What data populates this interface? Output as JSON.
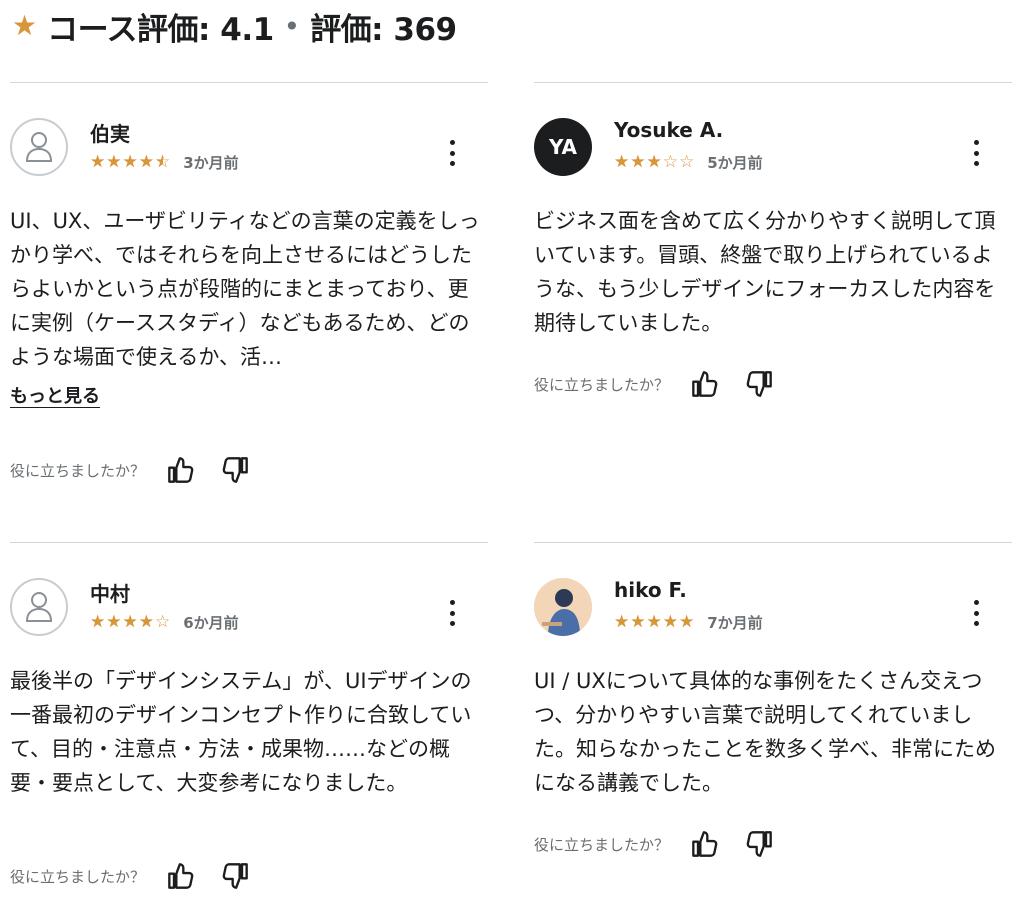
{
  "header": {
    "title": "コース評価: 4.1",
    "separator": "•",
    "count": "評価: 369",
    "accent_color": "#d8963a"
  },
  "helpful_prompt": "役に立ちましたか？",
  "reviews": [
    {
      "name": "伯実",
      "avatar": "user-outline-icon",
      "rating": 4.5,
      "date": "3か月前",
      "text": "UI、UX、ユーザビリティなどの言葉の定義をしっかり学べ、ではそれらを向上させるにはどうしたらよいかという点が段階的にまとまっており、更に実例（ケーススタディ）などもあるため、どのような場面で使えるか、活…",
      "more_label": "もっと見る"
    },
    {
      "name": "Yosuke A.",
      "avatar_initials": "YA",
      "rating": 3,
      "date": "5か月前",
      "text": "ビジネス面を含めて広く分かりやすく説明して頂いています。冒頭、終盤で取り上げられているような、もう少しデザインにフォーカスした内容を期待していました。"
    },
    {
      "name": "中村",
      "avatar": "user-outline-icon",
      "rating": 4,
      "date": "6か月前",
      "text": "最後半の「デザインシステム」が、UIデザインの一番最初のデザインコンセプト作りに合致していて、目的・注意点・方法・成果物……などの概要・要点として、大変参考になりました。"
    },
    {
      "name": "hiko F.",
      "avatar": "photo-avatar",
      "rating": 5,
      "date": "7か月前",
      "text": "UI / UXについて具体的な事例をたくさん交えつつ、分かりやすい言葉で説明してくれていました。知らなかったことを数多く学べ、非常にためになる講義でした。"
    }
  ]
}
